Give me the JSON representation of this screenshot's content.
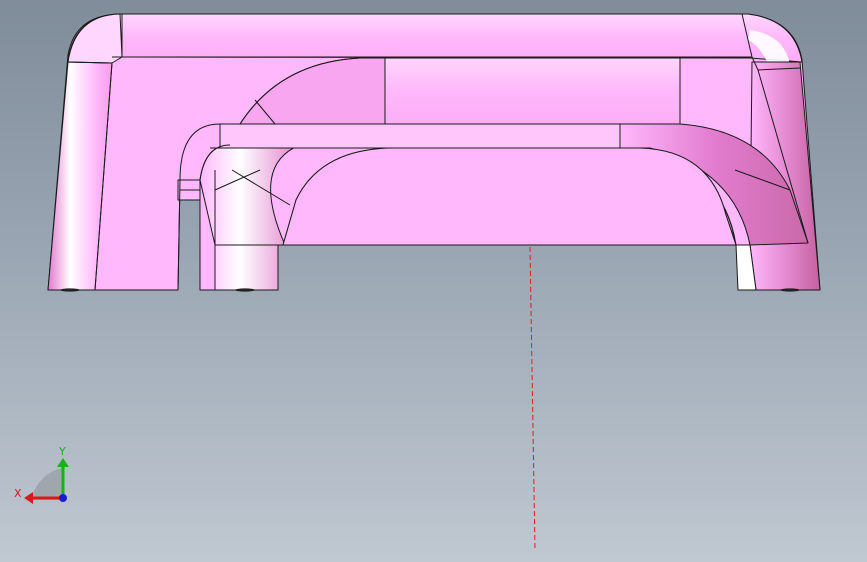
{
  "viewport": {
    "background_top": "#7f8c99",
    "background_bottom": "#c0c8d1"
  },
  "part": {
    "face_color": "#ffb8fb",
    "shade_color": "#d97bc7",
    "highlight_color": "#ffffff",
    "edge_color": "#1a1a1a"
  },
  "triad": {
    "x_label": "X",
    "y_label": "Y",
    "x_color": "#d91a1a",
    "y_color": "#1ab01a",
    "z_color": "#1a1ad9"
  },
  "centerline": {
    "color": "#d92020",
    "style": "dashed"
  }
}
